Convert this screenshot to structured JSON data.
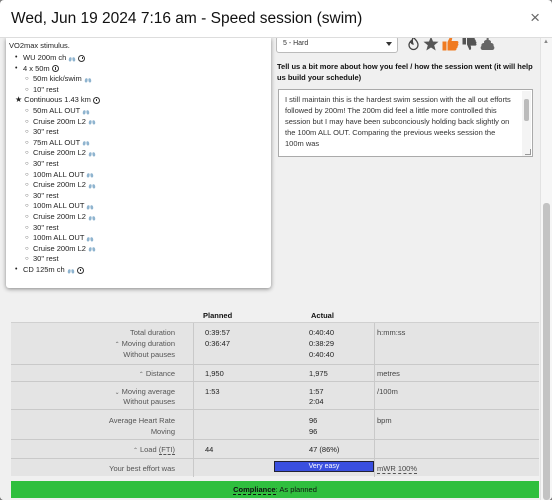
{
  "modal": {
    "title": "Wed, Jun 19 2024 7:16 am - Speed session (swim)",
    "close_glyph": "×"
  },
  "workout": {
    "intro": "VO2max stimulus.",
    "lines": [
      {
        "level": 0,
        "text": "WU 200m ch",
        "icons": [
          "lungs-icon",
          "clock-icon"
        ]
      },
      {
        "level": 0,
        "text": "4 x 50m",
        "icons": [
          "clock-icon"
        ]
      },
      {
        "level": 1,
        "text": "50m kick/swim",
        "icons": [
          "lungs-icon"
        ]
      },
      {
        "level": 1,
        "text": "10\" rest",
        "icons": []
      },
      {
        "level": 0,
        "text": "Continuous 1.43 km",
        "icons": [
          "clock-icon"
        ],
        "star": true
      },
      {
        "level": 1,
        "text": "50m ALL OUT",
        "icons": [
          "lungs-icon"
        ]
      },
      {
        "level": 1,
        "text": "Cruise 200m L2",
        "icons": [
          "lungs-icon"
        ]
      },
      {
        "level": 1,
        "text": "30\" rest",
        "icons": []
      },
      {
        "level": 1,
        "text": "75m ALL OUT",
        "icons": [
          "lungs-icon"
        ]
      },
      {
        "level": 1,
        "text": "Cruise 200m L2",
        "icons": [
          "lungs-icon"
        ]
      },
      {
        "level": 1,
        "text": "30\" rest",
        "icons": []
      },
      {
        "level": 1,
        "text": "100m ALL OUT",
        "icons": [
          "lungs-icon"
        ]
      },
      {
        "level": 1,
        "text": "Cruise 200m L2",
        "icons": [
          "lungs-icon"
        ]
      },
      {
        "level": 1,
        "text": "30\" rest",
        "icons": []
      },
      {
        "level": 1,
        "text": "100m ALL OUT",
        "icons": [
          "lungs-icon"
        ]
      },
      {
        "level": 1,
        "text": "Cruise 200m L2",
        "icons": [
          "lungs-icon"
        ]
      },
      {
        "level": 1,
        "text": "30\" rest",
        "icons": []
      },
      {
        "level": 1,
        "text": "100m ALL OUT",
        "icons": [
          "lungs-icon"
        ]
      },
      {
        "level": 1,
        "text": "Cruise 200m L2",
        "icons": [
          "lungs-icon"
        ]
      },
      {
        "level": 1,
        "text": "30\" rest",
        "icons": []
      },
      {
        "level": 0,
        "text": "CD 125m ch",
        "icons": [
          "lungs-icon",
          "clock-icon"
        ]
      }
    ]
  },
  "feedback": {
    "intensity_value": "5 - Hard",
    "question": "Tell us a bit more about how you feel / how the session went (it will help us build your schedule)",
    "comment": "I still maintain this is the hardest swim session with the all out efforts followed by 200m! The 200m did feel a little more controlled this session but I may have been subconciously holding back slightly on the 100m ALL OUT. Comparing the previous weeks session the 100m was"
  },
  "stats": {
    "planned_header": "Planned",
    "actual_header": "Actual",
    "total_duration_label": "Total duration",
    "moving_duration_label": "Moving duration",
    "without_pauses_label": "Without pauses",
    "total_duration_planned": "0:39:57",
    "moving_duration_planned": "0:36:47",
    "total_duration_actual": "0:40:40",
    "moving_duration_actual": "0:38:29",
    "without_pauses_actual": "0:40:40",
    "duration_unit": "h:mm:ss",
    "distance_label": "Distance",
    "distance_planned": "1,950",
    "distance_actual": "1,975",
    "distance_unit": "metres",
    "moving_average_label": "Moving average",
    "avg_without_pauses_label": "Without pauses",
    "pace_planned": "1:53",
    "pace_actual_moving": "1:57",
    "pace_actual_without": "2:04",
    "pace_unit": "/100m",
    "hr_label": "Average Heart Rate",
    "hr_moving_label": "Moving",
    "hr_actual": "96",
    "hr_actual_moving": "96",
    "hr_unit": "bpm",
    "load_label": "Load",
    "load_abbr": "(FTI)",
    "load_planned": "44",
    "load_actual": "47 (86%)",
    "best_effort_label": "Your best effort was",
    "best_effort_value": "Very easy",
    "mwr": "mWR 100%"
  },
  "compliance": {
    "label": "Compliance",
    "value": ": As planned",
    "color": "#2fbf3e"
  }
}
